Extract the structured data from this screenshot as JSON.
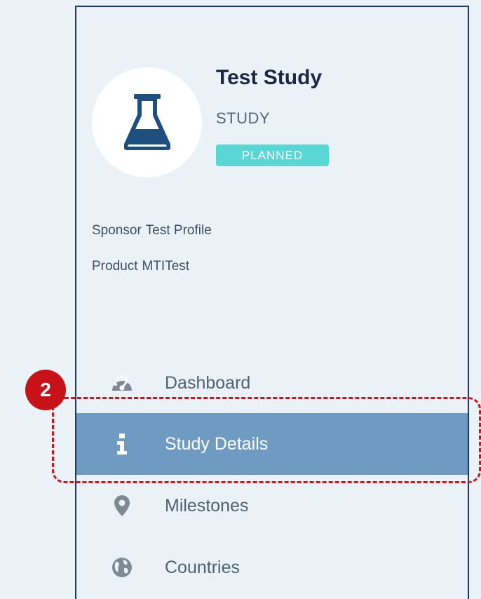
{
  "study": {
    "title": "Test Study",
    "type": "STUDY",
    "status": "PLANNED",
    "icon": "flask-icon"
  },
  "meta": {
    "sponsor_label": "Sponsor",
    "sponsor_value": "Test Profile",
    "product_label": "Product",
    "product_value": "MTITest"
  },
  "nav": {
    "items": [
      {
        "label": "Dashboard",
        "icon": "dashboard-gauge-icon"
      },
      {
        "label": "Study Details",
        "icon": "info-icon",
        "active": true
      },
      {
        "label": "Milestones",
        "icon": "map-marker-icon"
      },
      {
        "label": "Countries",
        "icon": "globe-icon"
      }
    ]
  },
  "callout": {
    "number": "2"
  },
  "colors": {
    "background": "#ebf3f9",
    "panel_border": "#1c3a6e",
    "active_item": "#6f9ac2",
    "status_badge": "#5ad6d4",
    "callout_red": "#c8121a",
    "flask_icon": "#1f4f7f"
  }
}
